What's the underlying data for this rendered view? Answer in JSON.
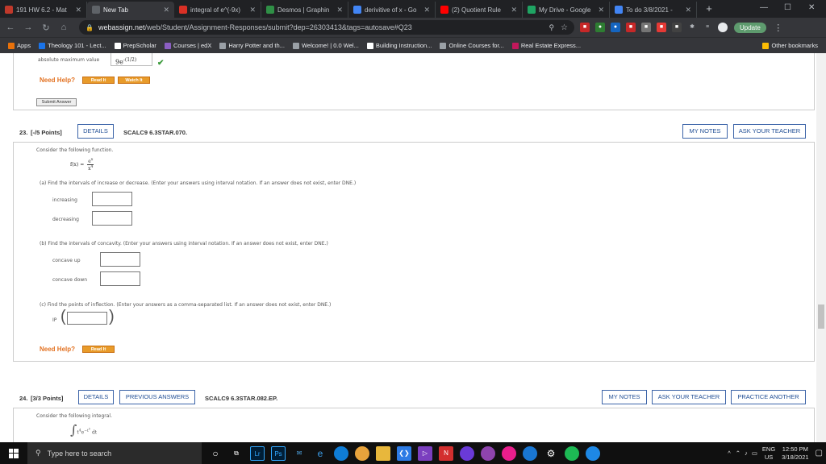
{
  "tabs": [
    {
      "label": "191 HW 6.2 - Mat",
      "icon": "webassign-icon",
      "color": "#c0392b",
      "active": false
    },
    {
      "label": "New Tab",
      "icon": "newtab-icon",
      "color": "#5f6368",
      "active": true
    },
    {
      "label": "integral of e^(-9x)",
      "icon": "symbolab-icon",
      "color": "#d93025",
      "active": false
    },
    {
      "label": "Desmos | Graphin",
      "icon": "desmos-icon",
      "color": "#2f8f46",
      "active": false
    },
    {
      "label": "derivitive of x - Go",
      "icon": "google-icon",
      "color": "#4285f4",
      "active": false
    },
    {
      "label": "(2) Quotient Rule",
      "icon": "youtube-icon",
      "color": "#ff0000",
      "active": false
    },
    {
      "label": "My Drive - Google",
      "icon": "drive-icon",
      "color": "#1fa463",
      "active": false
    },
    {
      "label": "To do 3/8/2021 -",
      "icon": "docs-icon",
      "color": "#4285f4",
      "active": false
    }
  ],
  "address": {
    "host": "webassign.net",
    "path": "/web/Student/Assignment-Responses/submit?dep=26303413&tags=autosave#Q23",
    "update_label": "Update"
  },
  "bookmarks": [
    {
      "label": "Apps",
      "color": "#e8710a"
    },
    {
      "label": "Theology 101 - Lect...",
      "color": "#1a73e8"
    },
    {
      "label": "PrepScholar",
      "color": "#ffffff"
    },
    {
      "label": "Courses | edX",
      "color": "#8b5ec2"
    },
    {
      "label": "Harry Potter and th...",
      "color": "#9aa0a6"
    },
    {
      "label": "Welcome! | 0.0 Wel...",
      "color": "#9aa0a6"
    },
    {
      "label": "Building Instruction...",
      "color": "#ffffff"
    },
    {
      "label": "Online Courses for...",
      "color": "#9aa0a6"
    },
    {
      "label": "Real Estate Express...",
      "color": "#c2185b"
    }
  ],
  "other_bookmarks": "Other bookmarks",
  "q22": {
    "label": "absolute maximum value",
    "answer": "9e",
    "exponent": "-(1/2)",
    "need_help": "Need Help?",
    "read_it": "Read It",
    "watch_it": "Watch It",
    "submit": "Submit Answer"
  },
  "q23": {
    "number": "23.",
    "points": "[-/5 Points]",
    "details": "DETAILS",
    "code": "SCALC9 6.3STAR.070.",
    "my_notes": "MY NOTES",
    "ask_teacher": "ASK YOUR TEACHER",
    "intro": "Consider the following function.",
    "fx": "f(x) =",
    "num": "e",
    "num_exp": "x",
    "den": "x",
    "den_exp": "4",
    "part_a": "(a)   Find the intervals of increase or decrease. (Enter your answers using interval notation. If an answer does not exist, enter DNE.)",
    "increasing": "increasing",
    "decreasing": "decreasing",
    "part_b": "(b)   Find the intervals of concavity. (Enter your answers using interval notation. If an answer does not exist, enter DNE.)",
    "concave_up": "concave up",
    "concave_down": "concave down",
    "part_c": "(c)   Find the points of inflection. (Enter your answers as a comma-separated list. If an answer does not exist, enter DNE.)",
    "ip": "IP",
    "need_help": "Need Help?",
    "read_it": "Read It"
  },
  "q24": {
    "number": "24.",
    "points": "[3/3 Points]",
    "details": "DETAILS",
    "previous": "PREVIOUS ANSWERS",
    "code": "SCALC9 6.3STAR.082.EP.",
    "my_notes": "MY NOTES",
    "ask_teacher": "ASK YOUR TEACHER",
    "practice": "PRACTICE ANOTHER",
    "intro": "Consider the following integral.",
    "integral": "∫",
    "integrand_base": "t",
    "integrand_exp": "4",
    "e": "e",
    "e_exp": "−t",
    "e_exp2": "5",
    "dt": "dt"
  },
  "taskbar": {
    "search": "Type here to search",
    "lang": "ENG",
    "region": "US",
    "time": "12:50 PM",
    "date": "3/18/2021"
  }
}
